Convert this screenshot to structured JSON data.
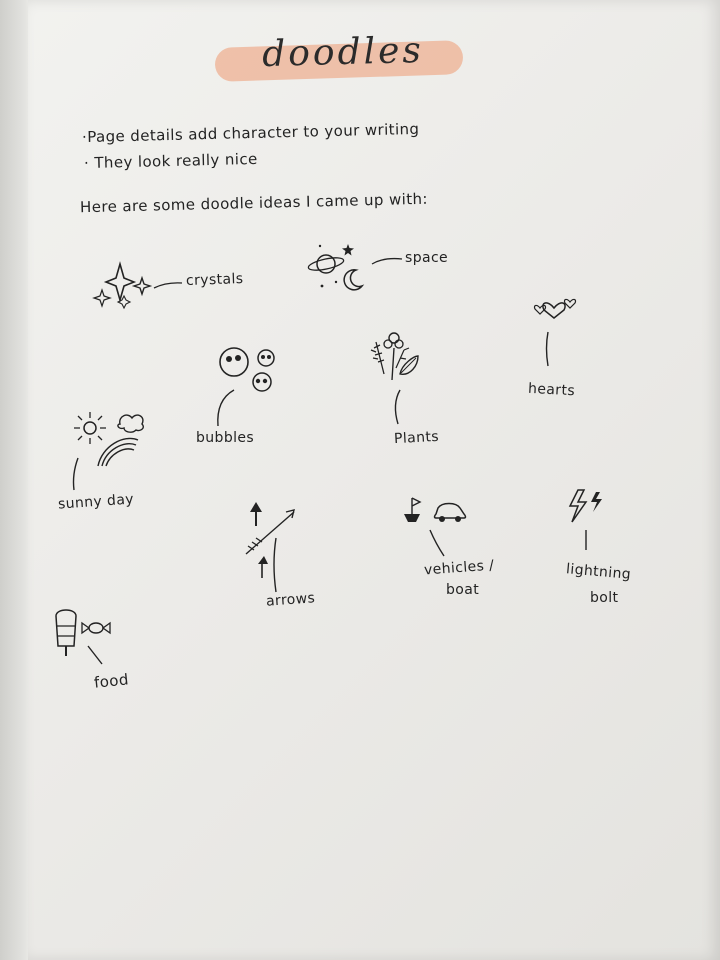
{
  "page": {
    "title": "doodles",
    "bullets": [
      "·Page details add character to your writing",
      "· They look really nice"
    ],
    "intro": "Here are some doodle ideas I came up with:"
  },
  "doodle_labels": {
    "crystals": "crystals",
    "space": "space",
    "bubbles": "bubbles",
    "plants": "Plants",
    "hearts": "hearts",
    "sunny_day": "sunny day",
    "arrows": "arrows",
    "vehicles_line1": "vehicles /",
    "vehicles_line2": "boat",
    "lightning_line1": "lightning",
    "lightning_line2": "bolt",
    "food": "food"
  },
  "colors": {
    "ink": "#232323",
    "highlight": "#eeb69a",
    "paper": "#efefec"
  },
  "icons": [
    "sparkle-icon",
    "planet-icon",
    "moon-icon",
    "star-icon",
    "bubble-icon",
    "flower-icon",
    "leaf-icon",
    "heart-icon",
    "sun-icon",
    "cloud-icon",
    "rainbow-icon",
    "arrow-icon",
    "flag-boat-icon",
    "car-icon",
    "lightning-icon",
    "ice-lolly-icon",
    "candy-icon"
  ]
}
